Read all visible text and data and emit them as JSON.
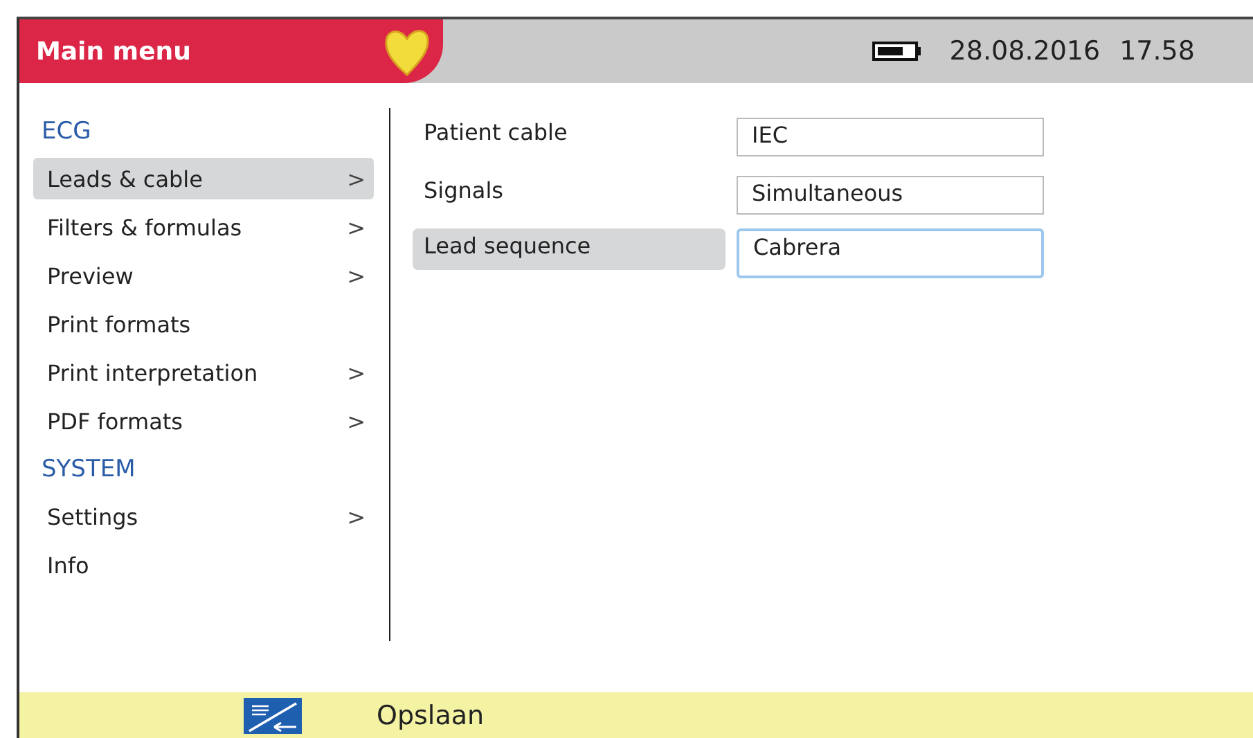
{
  "header": {
    "title": "Main menu",
    "date": "28.08.2016",
    "time": "17.58"
  },
  "menu": [
    {
      "kind": "section",
      "label": "ECG"
    },
    {
      "kind": "item",
      "label": "Leads & cable",
      "arrow": ">",
      "selected": true
    },
    {
      "kind": "item",
      "label": "Filters & formulas",
      "arrow": ">",
      "selected": false
    },
    {
      "kind": "item",
      "label": "Preview",
      "arrow": ">",
      "selected": false
    },
    {
      "kind": "item",
      "label": "Print formats",
      "selected": false
    },
    {
      "kind": "item",
      "label": "Print interpretation",
      "arrow": ">",
      "selected": false
    },
    {
      "kind": "item",
      "label": "PDF formats",
      "arrow": ">",
      "selected": false
    },
    {
      "kind": "section",
      "label": "SYSTEM"
    },
    {
      "kind": "item",
      "label": "Settings",
      "arrow": ">",
      "selected": false
    },
    {
      "kind": "item",
      "label": "Info",
      "selected": false
    }
  ],
  "settings": [
    {
      "label": "Patient cable",
      "value": "IEC",
      "selected": false
    },
    {
      "label": "Signals",
      "value": "Simultaneous",
      "selected": false
    },
    {
      "label": "Lead sequence",
      "value": "Cabrera",
      "selected": true
    }
  ],
  "footer": {
    "action": "Opslaan"
  }
}
